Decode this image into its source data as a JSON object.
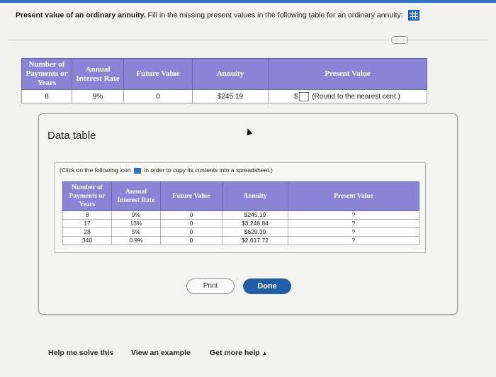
{
  "question": {
    "title": "Present value of an ordinary annuity.",
    "text": "Fill in the missing present values in the following table for an ordinary annuity:"
  },
  "main_table": {
    "headers": [
      "Number of Payments or Years",
      "Annual Interest Rate",
      "Future Value",
      "Annuity",
      "Present Value"
    ],
    "row": {
      "payments": "8",
      "rate": "9%",
      "future_value": "0",
      "annuity": "$245.19",
      "currency": "$",
      "hint": "(Round to the nearest cent.)"
    }
  },
  "modal": {
    "title": "Data table",
    "copy_note_before": "(Click on the following icon",
    "copy_note_after": "in order to copy its contents into a spreadsheet.)",
    "table": {
      "headers": [
        "Number of Payments or Years",
        "Annual Interest Rate",
        "Future Value",
        "Annuity",
        "Present Value"
      ],
      "rows": [
        {
          "payments": "8",
          "rate": "9%",
          "fv": "0",
          "annuity": "$245.19",
          "pv": "?"
        },
        {
          "payments": "17",
          "rate": "13%",
          "fv": "0",
          "annuity": "$3,248.84",
          "pv": "?"
        },
        {
          "payments": "28",
          "rate": "5%",
          "fv": "0",
          "annuity": "$629.39",
          "pv": "?"
        },
        {
          "payments": "340",
          "rate": "0.9%",
          "fv": "0",
          "annuity": "$2,617.72",
          "pv": "?"
        }
      ]
    },
    "print_label": "Print",
    "done_label": "Done",
    "close_symbol": "×"
  },
  "footer": {
    "help_label": "Help me solve this",
    "example_label": "View an example",
    "more_help_label": "Get more help",
    "more_help_caret": "▲"
  },
  "more_button": "····"
}
